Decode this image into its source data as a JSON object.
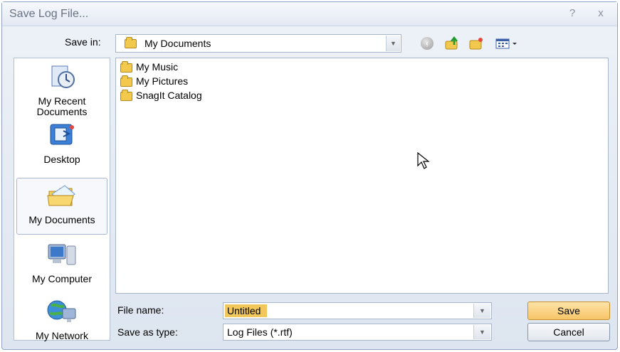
{
  "window": {
    "title": "Save Log File...",
    "help_glyph": "?",
    "close_glyph": "x"
  },
  "toolbar": {
    "save_in_label": "Save in:",
    "save_in_value": "My Documents",
    "icons": [
      "back-icon",
      "up-folder-icon",
      "new-folder-icon",
      "views-menu-icon"
    ]
  },
  "places": [
    {
      "label": "My Recent Documents",
      "icon": "recent-documents-icon",
      "selected": false
    },
    {
      "label": "Desktop",
      "icon": "desktop-icon",
      "selected": false
    },
    {
      "label": "My Documents",
      "icon": "my-documents-icon",
      "selected": true
    },
    {
      "label": "My Computer",
      "icon": "my-computer-icon",
      "selected": false
    },
    {
      "label": "My Network",
      "icon": "my-network-icon",
      "selected": false
    }
  ],
  "files": [
    {
      "name": "My Music",
      "icon": "music-folder-icon"
    },
    {
      "name": "My Pictures",
      "icon": "pictures-folder-icon"
    },
    {
      "name": "SnagIt Catalog",
      "icon": "folder-icon"
    }
  ],
  "form": {
    "file_name_label": "File name:",
    "file_name_value": "Untitled",
    "save_as_type_label": "Save as type:",
    "save_as_type_value": "Log Files (*.rtf)"
  },
  "buttons": {
    "save": "Save",
    "cancel": "Cancel"
  },
  "colors": {
    "accent_save": "#f8c567",
    "selection": "#f2c85c",
    "frame": "#8fa3c0"
  }
}
